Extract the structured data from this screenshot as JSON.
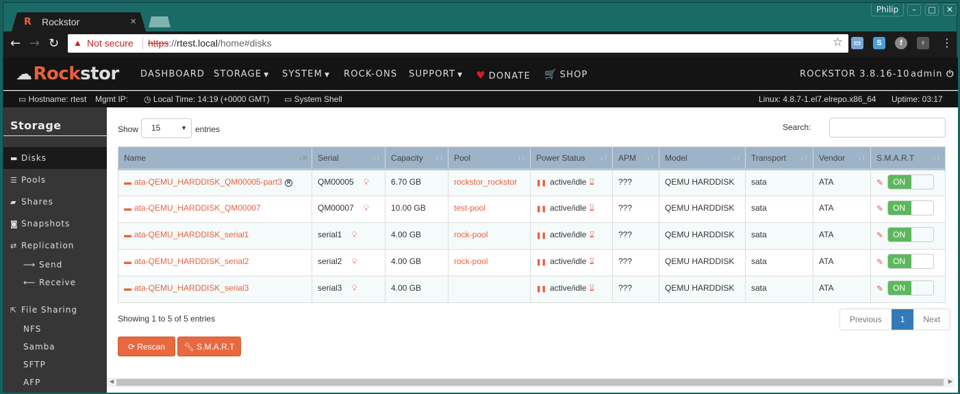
{
  "browser": {
    "tab_title": "Rockstor",
    "tab_favicon": "R",
    "user": "Philip",
    "window_controls": [
      "minimize",
      "maximize",
      "close"
    ],
    "security_label": "Not secure",
    "url_scheme": "https",
    "url_rest_sep": "://",
    "url_host": "rtest.local",
    "url_path": "/home#disks",
    "extensions": [
      "screen-icon",
      "s-icon",
      "fedora-icon",
      "bulb-icon"
    ]
  },
  "header": {
    "logo_rock": "Rock",
    "logo_stor": "stor",
    "nav": [
      {
        "label": "DASHBOARD",
        "dropdown": false
      },
      {
        "label": "STORAGE",
        "dropdown": true
      },
      {
        "label": "SYSTEM",
        "dropdown": true
      },
      {
        "label": "ROCK-ONS",
        "dropdown": false
      },
      {
        "label": "SUPPORT",
        "dropdown": true
      },
      {
        "label": "DONATE",
        "icon": "heart-icon"
      },
      {
        "label": "SHOP",
        "icon": "cart-icon"
      }
    ],
    "version": "ROCKSTOR 3.8.16-10",
    "user": "admin"
  },
  "infobar": {
    "hostname": "Hostname: rtest",
    "mgmt_ip": "Mgmt IP:",
    "local_time": "Local Time: 14:19 (+0000 GMT)",
    "system_shell": "System Shell",
    "kernel": "Linux: 4.8.7-1.el7.elrepo.x86_64",
    "uptime": "Uptime: 03:17"
  },
  "sidebar": {
    "title": "Storage",
    "items": [
      {
        "label": "Disks",
        "active": true
      },
      {
        "label": "Pools"
      },
      {
        "label": "Shares"
      },
      {
        "label": "Snapshots"
      },
      {
        "label": "Replication"
      }
    ],
    "replication_sub": [
      "Send",
      "Receive"
    ],
    "file_sharing": "File Sharing",
    "file_sharing_sub": [
      "NFS",
      "Samba",
      "SFTP",
      "AFP"
    ]
  },
  "table_controls": {
    "show_label": "Show",
    "page_length": "15",
    "entries_label": "entries",
    "search_label": "Search:",
    "search_value": ""
  },
  "table": {
    "columns": [
      "Name",
      "Serial",
      "Capacity",
      "Pool",
      "Power Status",
      "APM",
      "Model",
      "Transport",
      "Vendor",
      "S.M.A.R.T"
    ],
    "rows": [
      {
        "name": "ata-QEMU_HARDDISK_QM00005-part3",
        "root": true,
        "serial": "QM00005",
        "capacity": "6.70 GB",
        "pool": "rockstor_rockstor",
        "power": "active/idle",
        "apm": "???",
        "model": "QEMU HARDDISK",
        "transport": "sata",
        "vendor": "ATA",
        "smart": "ON"
      },
      {
        "name": "ata-QEMU_HARDDISK_QM00007",
        "root": false,
        "serial": "QM00007",
        "capacity": "10.00 GB",
        "pool": "test-pool",
        "power": "active/idle",
        "apm": "???",
        "model": "QEMU HARDDISK",
        "transport": "sata",
        "vendor": "ATA",
        "smart": "ON"
      },
      {
        "name": "ata-QEMU_HARDDISK_serial1",
        "root": false,
        "serial": "serial1",
        "capacity": "4.00 GB",
        "pool": "rock-pool",
        "power": "active/idle",
        "apm": "???",
        "model": "QEMU HARDDISK",
        "transport": "sata",
        "vendor": "ATA",
        "smart": "ON"
      },
      {
        "name": "ata-QEMU_HARDDISK_serial2",
        "root": false,
        "serial": "serial2",
        "capacity": "4.00 GB",
        "pool": "rock-pool",
        "power": "active/idle",
        "apm": "???",
        "model": "QEMU HARDDISK",
        "transport": "sata",
        "vendor": "ATA",
        "smart": "ON"
      },
      {
        "name": "ata-QEMU_HARDDISK_serial3",
        "root": false,
        "serial": "serial3",
        "capacity": "4.00 GB",
        "pool": "",
        "power": "active/idle",
        "apm": "???",
        "model": "QEMU HARDDISK",
        "transport": "sata",
        "vendor": "ATA",
        "smart": "ON"
      }
    ]
  },
  "footer": {
    "info": "Showing 1 to 5 of 5 entries",
    "prev": "Previous",
    "page": "1",
    "next": "Next",
    "rescan": "Rescan",
    "smart": "S.M.A.R.T"
  },
  "colors": {
    "accent": "#e8613d",
    "header_bg": "#9db3c8",
    "toggle_on": "#5cb85c",
    "page_active": "#337ab7"
  }
}
